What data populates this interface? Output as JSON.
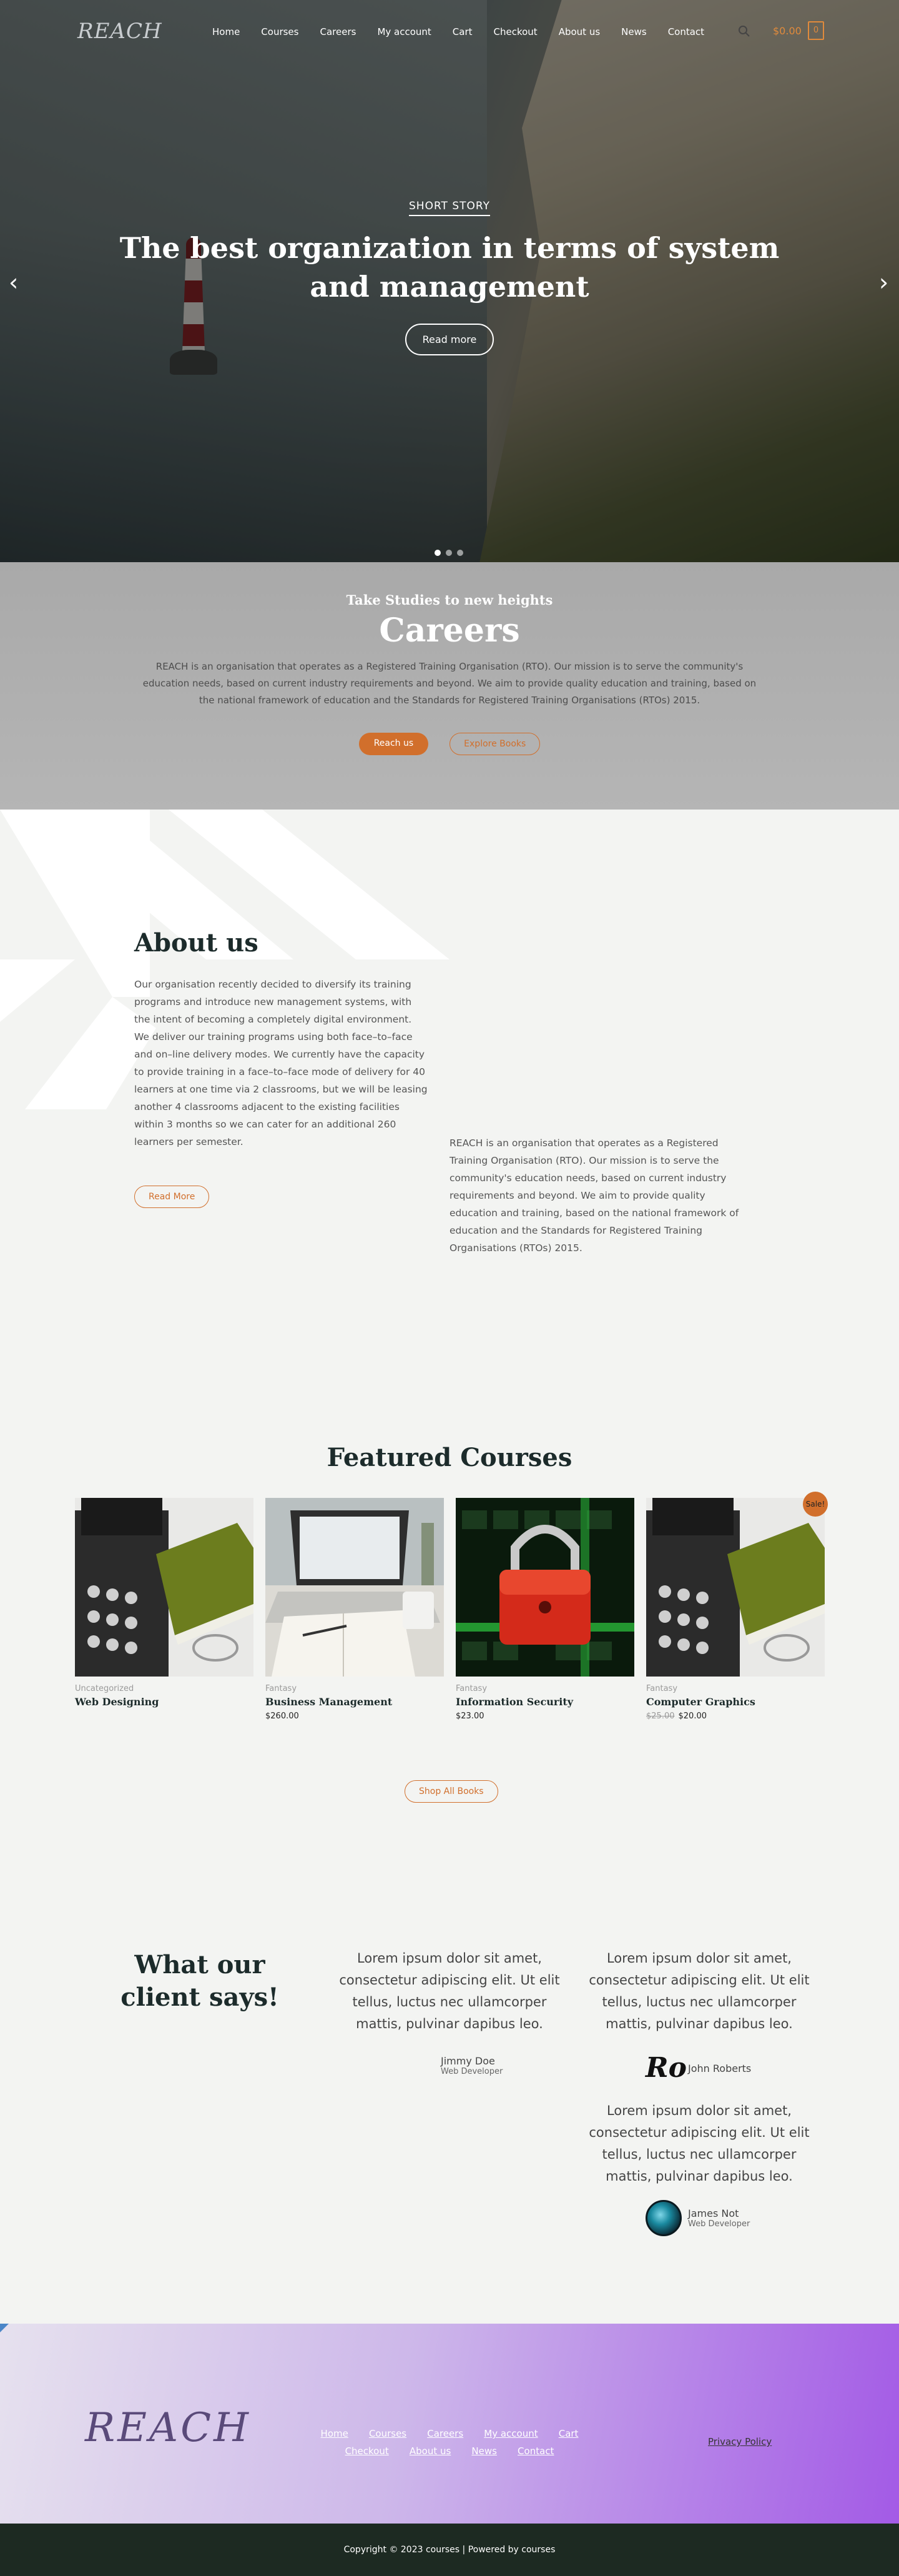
{
  "header": {
    "logo_text": "REACH",
    "nav": [
      "Home",
      "Courses",
      "Careers",
      "My account",
      "Cart",
      "Checkout",
      "About us",
      "News",
      "Contact"
    ],
    "cart_total": "$0.00",
    "cart_count": "0"
  },
  "hero": {
    "eyebrow": "SHORT STORY",
    "title": "The best organization in terms of system and management",
    "button": "Read more",
    "prev_arrow": "‹",
    "next_arrow": "›",
    "slide_count": 3,
    "active_slide": 1
  },
  "careers": {
    "subtitle": "Take Studies to new heights",
    "title": "Careers",
    "text": "REACH is an organisation that operates as a Registered Training Organisation (RTO). Our mission is to serve the community's education needs, based on current industry requirements and beyond. We aim to provide quality education and training, based on the national framework of education and the Standards for Registered Training Organisations (RTOs) 2015.",
    "primary_button": "Reach us",
    "secondary_button": "Explore Books"
  },
  "about": {
    "title": "About us",
    "left_text": "Our organisation recently decided to diversify its training programs and introduce new management systems, with the intent of becoming a completely digital environment. We deliver our training programs using both face–to–face and on–line delivery modes. We currently have the capacity to provide training in a face–to–face mode of delivery for 40 learners at one time via 2 classrooms, but we will be leasing another 4 classrooms adjacent to the existing facilities within 3 months so we can cater for an additional 260 learners per semester.",
    "right_text": "REACH is an organisation that operates as a Registered Training Organisation (RTO). Our mission is to serve the community's education needs, based on current industry requirements and beyond. We aim to provide quality education and training, based on the national framework of education and the Standards for Registered Training Organisations (RTOs) 2015.",
    "button": "Read More"
  },
  "featured": {
    "title": "Featured Courses",
    "products": [
      {
        "category": "Uncategorized",
        "name": "Web Designing",
        "price": "",
        "old_price": "",
        "image": "typewriter-book"
      },
      {
        "category": "Fantasy",
        "name": "Business Management",
        "price": "$260.00",
        "old_price": "",
        "image": "laptop-desk"
      },
      {
        "category": "Fantasy",
        "name": "Information Security",
        "price": "$23.00",
        "old_price": "",
        "image": "padlock-keyboard"
      },
      {
        "category": "Fantasy",
        "name": "Computer Graphics",
        "price": "$20.00",
        "old_price": "$25.00",
        "image": "typewriter-book"
      }
    ],
    "sale_badge": "Sale!",
    "shop_all": "Shop All Books"
  },
  "testimonials": {
    "title": "What our client says!",
    "items": [
      {
        "quote": "Lorem ipsum dolor sit amet, consectetur adipiscing elit. Ut elit tellus, luctus nec ullamcorper mattis, pulvinar dapibus leo.",
        "name": "Jimmy Doe",
        "role": "Web Developer"
      },
      {
        "quote": "Lorem ipsum dolor sit amet, consectetur adipiscing elit. Ut elit tellus, luctus nec ullamcorper mattis, pulvinar dapibus leo.",
        "name": "John Roberts",
        "role": "",
        "avatar_text": "Ro"
      },
      {
        "quote": "Lorem ipsum dolor sit amet, consectetur adipiscing elit. Ut elit tellus, luctus nec ullamcorper mattis, pulvinar dapibus leo.",
        "name": "James Not",
        "role": "Web Developer"
      }
    ]
  },
  "footer": {
    "logo_text": "REACH",
    "links": [
      "Home",
      "Courses",
      "Careers",
      "My account",
      "Cart",
      "Checkout",
      "About us",
      "News",
      "Contact"
    ],
    "privacy": "Privacy Policy",
    "copyright": "Copyright © 2023 courses | Powered by courses"
  },
  "colors": {
    "accent": "#d16f2c",
    "cart": "#e08a3c",
    "dark_heading": "#1c2b2b",
    "footer_bottom": "#1d2a22",
    "footer_gradient_end": "#a35ae6"
  }
}
